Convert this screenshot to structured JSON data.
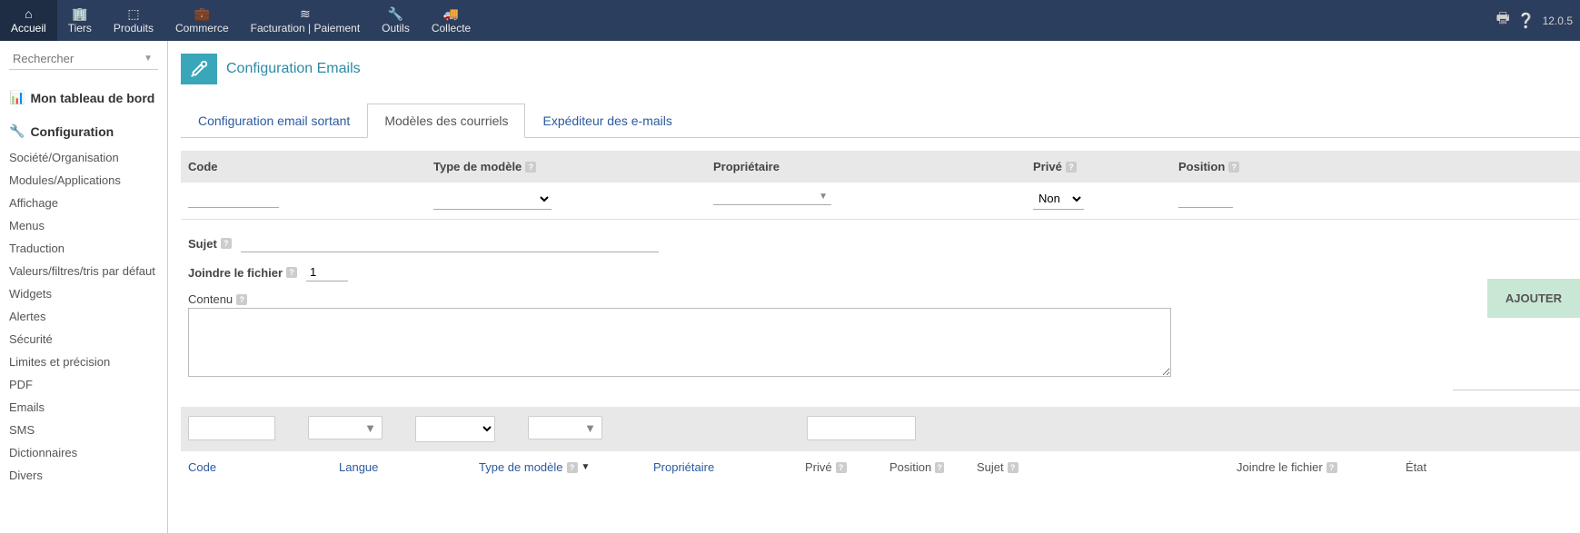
{
  "topnav": {
    "items": [
      {
        "label": "Accueil",
        "icon": "⌂",
        "active": true
      },
      {
        "label": "Tiers",
        "icon": "🏢",
        "active": false
      },
      {
        "label": "Produits",
        "icon": "📦",
        "active": false
      },
      {
        "label": "Commerce",
        "icon": "💼",
        "active": false
      },
      {
        "label": "Facturation | Paiement",
        "icon": "≋",
        "active": false
      },
      {
        "label": "Outils",
        "icon": "🔧",
        "active": false
      },
      {
        "label": "Collecte",
        "icon": "🚚",
        "active": false
      }
    ],
    "version": "12.0.5"
  },
  "sidebar": {
    "search_placeholder": "Rechercher",
    "dashboard_label": "Mon tableau de bord",
    "config_label": "Configuration",
    "items": [
      "Société/Organisation",
      "Modules/Applications",
      "Affichage",
      "Menus",
      "Traduction",
      "Valeurs/filtres/tris par défaut",
      "Widgets",
      "Alertes",
      "Sécurité",
      "Limites et précision",
      "PDF",
      "Emails",
      "SMS",
      "Dictionnaires",
      "Divers"
    ]
  },
  "page": {
    "title": "Configuration Emails",
    "tabs": [
      {
        "label": "Configuration email sortant",
        "active": false
      },
      {
        "label": "Modèles des courriels",
        "active": true
      },
      {
        "label": "Expéditeur des e-mails",
        "active": false
      }
    ]
  },
  "columns": {
    "code": "Code",
    "type": "Type de modèle",
    "owner": "Propriétaire",
    "private": "Privé",
    "position": "Position"
  },
  "filters": {
    "private_value": "Non"
  },
  "form": {
    "subject_label": "Sujet",
    "attach_label": "Joindre le fichier",
    "attach_value": "1",
    "content_label": "Contenu",
    "add_button": "AJOUTER"
  },
  "list_header": {
    "code": "Code",
    "langue": "Langue",
    "type": "Type de modèle",
    "owner": "Propriétaire",
    "prive": "Privé",
    "position": "Position",
    "sujet": "Sujet",
    "attach": "Joindre le fichier",
    "etat": "État"
  }
}
